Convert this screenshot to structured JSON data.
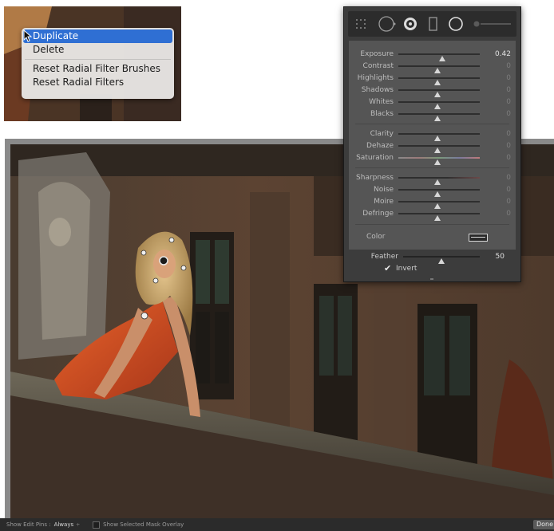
{
  "context_menu": {
    "items": [
      {
        "label": "Duplicate",
        "selected": true
      },
      {
        "label": "Delete",
        "selected": false
      },
      {
        "label": "Reset Radial Filter Brushes",
        "selected": false
      },
      {
        "label": "Reset Radial Filters",
        "selected": false
      }
    ]
  },
  "panel": {
    "tools": [
      "grid-dots-icon",
      "spot-removal-icon",
      "radial-filter-icon",
      "graduated-filter-icon",
      "brush-circle-icon",
      "brush-size-slider"
    ],
    "adjustments": [
      {
        "label": "Exposure",
        "value": "0.42"
      },
      {
        "label": "Contrast",
        "value": "0"
      },
      {
        "label": "Highlights",
        "value": "0"
      },
      {
        "label": "Shadows",
        "value": "0"
      },
      {
        "label": "Whites",
        "value": "0"
      },
      {
        "label": "Blacks",
        "value": "0"
      },
      {
        "label": "Clarity",
        "value": "0"
      },
      {
        "label": "Dehaze",
        "value": "0"
      },
      {
        "label": "Saturation",
        "value": "0"
      },
      {
        "label": "Sharpness",
        "value": "0"
      },
      {
        "label": "Noise",
        "value": "0"
      },
      {
        "label": "Moire",
        "value": "0"
      },
      {
        "label": "Defringe",
        "value": "0"
      }
    ],
    "color_label": "Color",
    "feather": {
      "label": "Feather",
      "value": "50"
    },
    "invert": {
      "label": "Invert",
      "checked": true,
      "check_glyph": "✔"
    }
  },
  "toolbar": {
    "show_edit_pins_label": "Show Edit Pins :",
    "show_edit_pins_value": "Always",
    "dropdown_glyph": "÷",
    "overlay_label": "Show Selected Mask Overlay",
    "done_label": "Done"
  },
  "colors": {
    "menu_highlight": "#2f6fd3",
    "panel_bg": "#3c3c3c",
    "slider_bg": "#555555"
  }
}
